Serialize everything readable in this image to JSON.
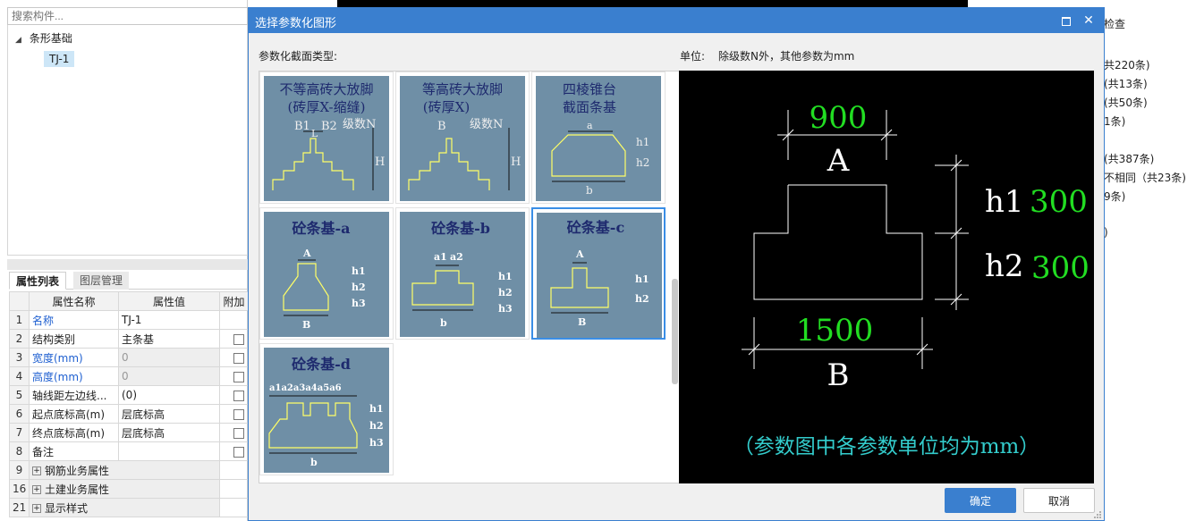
{
  "search": {
    "placeholder": "搜索构件..."
  },
  "tree": {
    "root_label": "条形基础",
    "child_label": "TJ-1"
  },
  "tabs": {
    "attr": "属性列表",
    "layer": "图层管理"
  },
  "prop_table": {
    "headers": [
      "属性名称",
      "属性值",
      "附加"
    ],
    "rows": [
      {
        "num": "1",
        "name": "名称",
        "value": "TJ-1"
      },
      {
        "num": "2",
        "name": "结构类别",
        "value": "主条基"
      },
      {
        "num": "3",
        "name": "宽度(mm)",
        "value": "0"
      },
      {
        "num": "4",
        "name": "高度(mm)",
        "value": "0"
      },
      {
        "num": "5",
        "name": "轴线距左边线...",
        "value": "(0)"
      },
      {
        "num": "6",
        "name": "起点底标高(m)",
        "value": "层底标高"
      },
      {
        "num": "7",
        "name": "终点底标高(m)",
        "value": "层底标高"
      },
      {
        "num": "8",
        "name": "备注",
        "value": ""
      },
      {
        "num": "9",
        "name": "钢筋业务属性",
        "value": ""
      },
      {
        "num": "16",
        "name": "土建业务属性",
        "value": ""
      },
      {
        "num": "21",
        "name": "显示样式",
        "value": ""
      }
    ]
  },
  "right_panel": {
    "title_fragment": "检查",
    "items": [
      "共220条)",
      "(共13条)",
      "(共50条)",
      "1条)",
      "(共387条)",
      "不相同（共23条)",
      "9条)",
      ")"
    ]
  },
  "dialog": {
    "title": "选择参数化图形",
    "section_label": "参数化截面类型:",
    "unit_label": "单位:",
    "unit_text": "除级数N外，其他参数为mm",
    "ok": "确定",
    "cancel": "取消"
  },
  "thumbnails": [
    {
      "title1": "不等高砖大放脚",
      "title2": "(砖厚X-缩缝)",
      "labels": [
        "B1",
        "L",
        "B2",
        "级数N",
        "H"
      ]
    },
    {
      "title1": "等高砖大放脚",
      "title2": "(砖厚X)",
      "labels": [
        "B",
        "级数N",
        "H"
      ]
    },
    {
      "title1": "四棱锥台",
      "title2": "截面条基",
      "labels": [
        "a",
        "h1",
        "h2",
        "b"
      ]
    },
    {
      "title1": "砼条基-a",
      "labels": [
        "A",
        "h1",
        "h2",
        "h3",
        "B"
      ]
    },
    {
      "title1": "砼条基-b",
      "labels": [
        "a1",
        "a2",
        "h1",
        "h2",
        "h3",
        "b"
      ]
    },
    {
      "title1": "砼条基-c",
      "labels": [
        "A",
        "h1",
        "h2",
        "B"
      ]
    },
    {
      "title1": "砼条基-d",
      "labels": [
        "a1a2a3a4a5a6",
        "h1",
        "h2",
        "h3",
        "b"
      ]
    }
  ],
  "preview": {
    "a_value": "900",
    "a_label": "A",
    "h1_label": "h1",
    "h1_value": "300",
    "h2_label": "h2",
    "h2_value": "300",
    "b_value": "1500",
    "b_label": "B",
    "note": "（参数图中各参数单位均为mm）"
  },
  "colors": {
    "accent": "#3a7fcf",
    "thumb_bg": "#6f8fa6",
    "thumb_title": "#1e2a6e",
    "outline_yellow": "#ffff66",
    "value_green": "#22dd22",
    "note_cyan": "#33cccc",
    "link_blue": "#1e5fd0"
  }
}
